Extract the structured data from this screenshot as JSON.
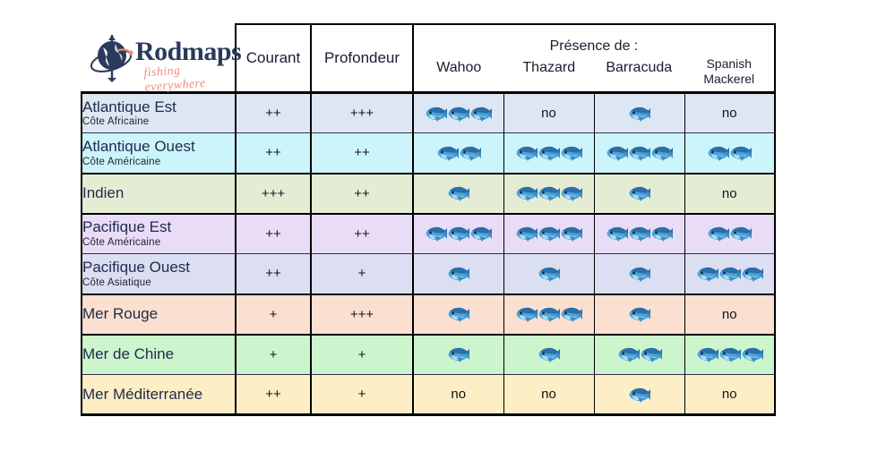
{
  "logo": {
    "name": "Rodmaps",
    "tagline": "fishing everywhere",
    "mark_icon": "fishing-rod-globe-icon"
  },
  "table": {
    "headers": {
      "current": "Courant",
      "depth": "Profondeur",
      "presence_group": "Présence de :",
      "species": [
        {
          "label": "Wahoo",
          "lines": [
            "Wahoo"
          ]
        },
        {
          "label": "Thazard",
          "lines": [
            "Thazard"
          ]
        },
        {
          "label": "Barracuda",
          "lines": [
            "Barracuda"
          ]
        },
        {
          "label": "Spanish Mackerel",
          "lines": [
            "Spanish",
            "Mackerel"
          ]
        }
      ]
    },
    "no_label": "no",
    "fish_icon": "fish-icon",
    "rows": [
      {
        "region": "Atlantique Est",
        "subtitle": "Côte Africaine",
        "bg": "#dde7f3",
        "separator": "thin",
        "current": "++",
        "depth": "+++",
        "presence": [
          {
            "species": "Wahoo",
            "fish": 3,
            "value": "3"
          },
          {
            "species": "Thazard",
            "fish": 0,
            "value": "no"
          },
          {
            "species": "Barracuda",
            "fish": 1,
            "value": "1"
          },
          {
            "species": "Spanish Mackerel",
            "fish": 0,
            "value": "no"
          }
        ]
      },
      {
        "region": "Atlantique Ouest",
        "subtitle": "Côte Américaine",
        "bg": "#ccf4fb",
        "separator": "thin",
        "current": "++",
        "depth": "++",
        "presence": [
          {
            "species": "Wahoo",
            "fish": 2,
            "value": "2"
          },
          {
            "species": "Thazard",
            "fish": 3,
            "value": "3"
          },
          {
            "species": "Barracuda",
            "fish": 3,
            "value": "3"
          },
          {
            "species": "Spanish Mackerel",
            "fish": 2,
            "value": "2"
          }
        ]
      },
      {
        "region": "Indien",
        "subtitle": "",
        "bg": "#e5ecd4",
        "separator": "thick",
        "current": "+++",
        "depth": "++",
        "presence": [
          {
            "species": "Wahoo",
            "fish": 1,
            "value": "1"
          },
          {
            "species": "Thazard",
            "fish": 3,
            "value": "3"
          },
          {
            "species": "Barracuda",
            "fish": 1,
            "value": "1"
          },
          {
            "species": "Spanish Mackerel",
            "fish": 0,
            "value": "no"
          }
        ]
      },
      {
        "region": "Pacifique Est",
        "subtitle": "Côte Américaine",
        "bg": "#e9dcf6",
        "separator": "thick",
        "current": "++",
        "depth": "++",
        "presence": [
          {
            "species": "Wahoo",
            "fish": 3,
            "value": "3"
          },
          {
            "species": "Thazard",
            "fish": 3,
            "value": "3"
          },
          {
            "species": "Barracuda",
            "fish": 3,
            "value": "3"
          },
          {
            "species": "Spanish Mackerel",
            "fish": 2,
            "value": "2"
          }
        ]
      },
      {
        "region": "Pacifique Ouest",
        "subtitle": "Côte Asiatique",
        "bg": "#dbdff1",
        "separator": "thin",
        "current": "++",
        "depth": "+",
        "presence": [
          {
            "species": "Wahoo",
            "fish": 1,
            "value": "1"
          },
          {
            "species": "Thazard",
            "fish": 1,
            "value": "1"
          },
          {
            "species": "Barracuda",
            "fish": 1,
            "value": "1"
          },
          {
            "species": "Spanish Mackerel",
            "fish": 3,
            "value": "3"
          }
        ]
      },
      {
        "region": "Mer Rouge",
        "subtitle": "",
        "bg": "#fbdfd0",
        "separator": "thick",
        "current": "+",
        "depth": "+++",
        "presence": [
          {
            "species": "Wahoo",
            "fish": 1,
            "value": "1"
          },
          {
            "species": "Thazard",
            "fish": 3,
            "value": "3"
          },
          {
            "species": "Barracuda",
            "fish": 1,
            "value": "1"
          },
          {
            "species": "Spanish Mackerel",
            "fish": 0,
            "value": "no"
          }
        ]
      },
      {
        "region": "Mer de Chine",
        "subtitle": "",
        "bg": "#ccf5cd",
        "separator": "thick",
        "current": "+",
        "depth": "+",
        "presence": [
          {
            "species": "Wahoo",
            "fish": 1,
            "value": "1"
          },
          {
            "species": "Thazard",
            "fish": 1,
            "value": "1"
          },
          {
            "species": "Barracuda",
            "fish": 2,
            "value": "2"
          },
          {
            "species": "Spanish Mackerel",
            "fish": 3,
            "value": "3"
          }
        ]
      },
      {
        "region": "Mer Méditerranée",
        "subtitle": "",
        "bg": "#fdeec5",
        "separator": "thin",
        "current": "++",
        "depth": "+",
        "presence": [
          {
            "species": "Wahoo",
            "fish": 0,
            "value": "no"
          },
          {
            "species": "Thazard",
            "fish": 0,
            "value": "no"
          },
          {
            "species": "Barracuda",
            "fish": 1,
            "value": "1"
          },
          {
            "species": "Spanish Mackerel",
            "fish": 0,
            "value": "no"
          }
        ]
      }
    ]
  }
}
